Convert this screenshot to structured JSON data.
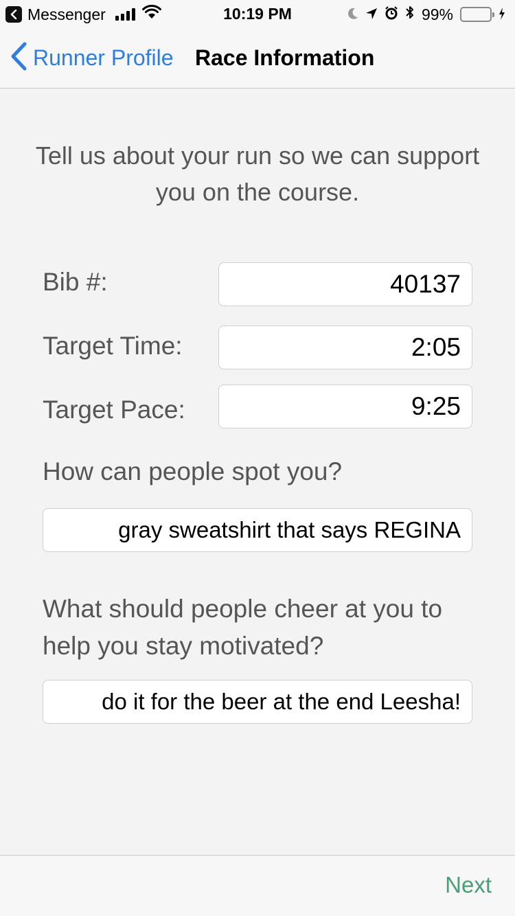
{
  "status_bar": {
    "back_app": "Messenger",
    "time": "10:19 PM",
    "battery": "99%",
    "battery_level": 0.99
  },
  "nav": {
    "back_label": "Runner Profile",
    "title": "Race Information",
    "accent_color": "#2f7de1"
  },
  "intro_text": "Tell us about your run so we can support you on the course.",
  "fields": {
    "bib": {
      "label": "Bib #:",
      "value": "40137"
    },
    "target_time": {
      "label": "Target Time:",
      "value": "2:05"
    },
    "target_pace": {
      "label": "Target Pace:",
      "value": "9:25"
    }
  },
  "spot": {
    "question": "How can people spot you?",
    "answer": "gray sweatshirt that says REGINA"
  },
  "cheer": {
    "question": "What should people cheer at you to help you stay motivated?",
    "answer": "do it for the beer at the end Leesha!"
  },
  "footer": {
    "next_label": "Next",
    "next_color": "#4a9e77"
  },
  "icons": [
    "back-app-chevron-icon",
    "signal-icon",
    "wifi-icon",
    "moon-icon",
    "location-icon",
    "alarm-icon",
    "bluetooth-icon",
    "battery-icon",
    "charging-icon",
    "back-chevron-icon"
  ]
}
